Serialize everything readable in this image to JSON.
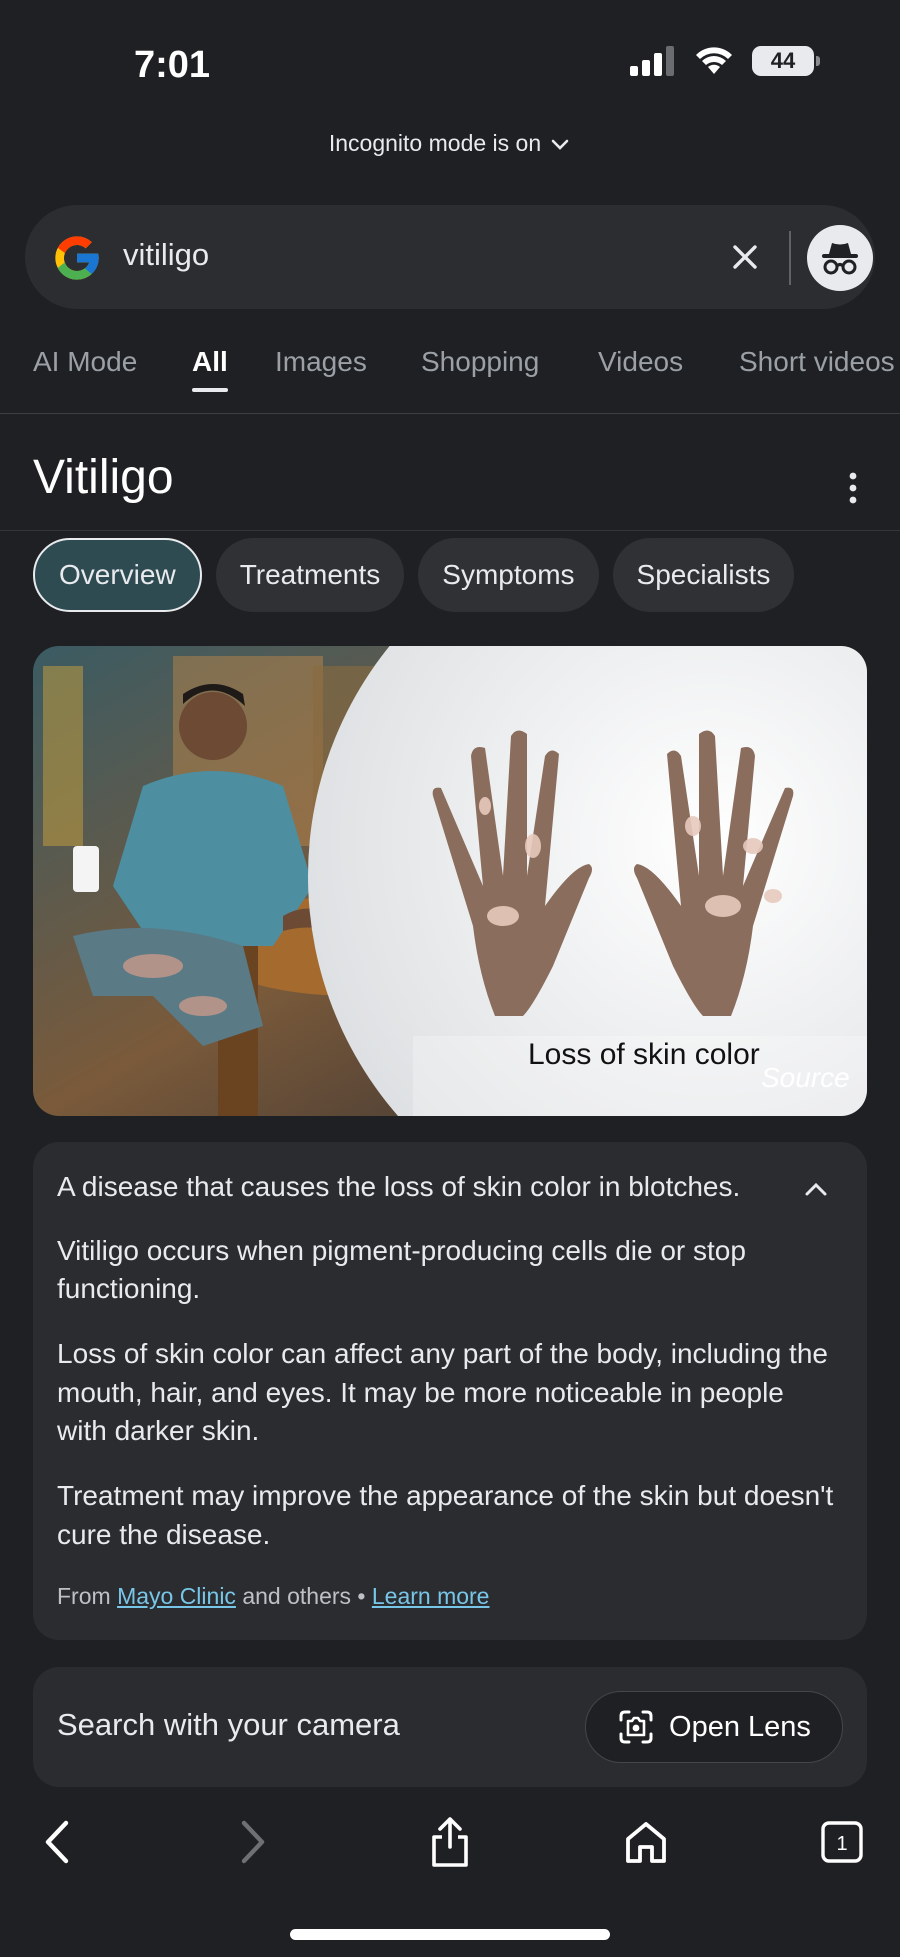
{
  "status_bar": {
    "time": "7:01",
    "battery": "44"
  },
  "incognito": {
    "label": "Incognito mode is on"
  },
  "search": {
    "query": "vitiligo"
  },
  "tabs": [
    "AI Mode",
    "All",
    "Images",
    "Shopping",
    "Videos",
    "Short videos"
  ],
  "active_tab": "All",
  "entity": {
    "title": "Vitiligo"
  },
  "chips": [
    "Overview",
    "Treatments",
    "Symptoms",
    "Specialists"
  ],
  "active_chip": "Overview",
  "hero": {
    "caption": "Loss of skin color",
    "source_label": "Source"
  },
  "overview": {
    "lead": "A disease that causes the loss of skin color in blotches.",
    "paragraphs": [
      "Vitiligo occurs when pigment-producing cells die or stop functioning.",
      "Loss of skin color can affect any part of the body, including the mouth, hair, and eyes. It may be more noticeable in people with darker skin.",
      "Treatment may improve the appearance of the skin but doesn't cure the disease."
    ],
    "source_prefix": "From",
    "source_link": "Mayo Clinic",
    "source_mid": "and others •",
    "learn_more": "Learn more"
  },
  "lens": {
    "prompt": "Search with your camera",
    "button": "Open Lens"
  },
  "bottom_nav": {
    "tabs_count": "1"
  }
}
